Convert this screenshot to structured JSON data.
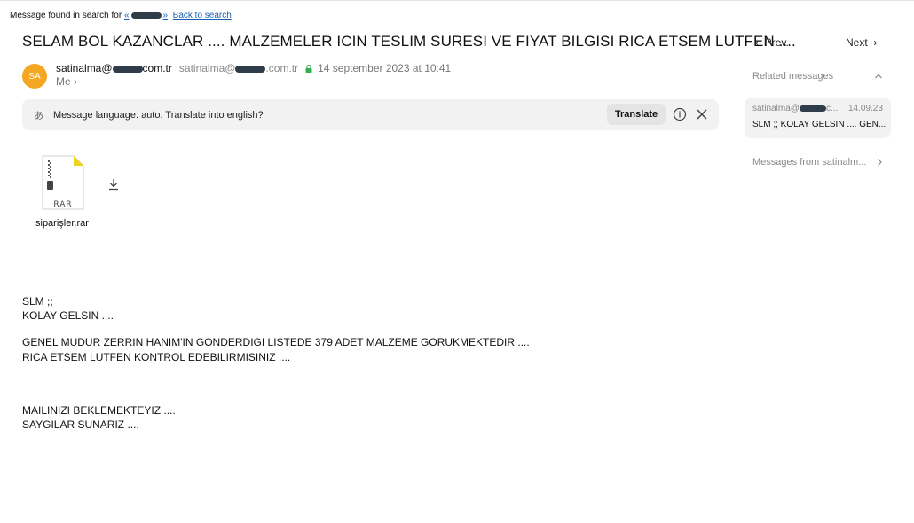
{
  "search_bar": {
    "prefix": "Message found in search for",
    "query_open": "«",
    "query_close": "»",
    "separator": ".",
    "back_link": "Back to search"
  },
  "message": {
    "subject": "SELAM BOL KAZANCLAR .... MALZEMELER ICIN TESLIM SURESI VE FIYAT BILGISI RICA ETSEM LUTFEN ....",
    "avatar_initials": "SA",
    "avatar_color": "#f5a623",
    "from_name_prefix": "satinalma@",
    "from_name_suffix": "com.tr",
    "from_email_prefix": "satinalma@",
    "from_email_suffix": ".com.tr",
    "date": "14 september 2023 at 10:41",
    "to": "Me"
  },
  "translate": {
    "text": "Message language: auto. Translate into english?",
    "button": "Translate"
  },
  "attachment": {
    "type_label": "RAR",
    "file_name": "siparişler.rar"
  },
  "body": {
    "line1": "SLM ;;",
    "line2": "KOLAY GELSIN ....",
    "line3": "GENEL MUDUR ZERRIN HANIM'IN GONDERDIGI LISTEDE 379 ADET MALZEME GORUKMEKTEDIR ....",
    "line4": "RICA ETSEM LUTFEN KONTROL EDEBILIRMISINIZ ....",
    "line5": "MAILINIZI BEKLEMEKTEYIZ ....",
    "line6": "SAYGILAR SUNARIZ ...."
  },
  "sidebar": {
    "prev": "Prev.",
    "next": "Next",
    "related_title": "Related messages",
    "related_item": {
      "from_prefix": "satinalma@",
      "from_suffix": "c...",
      "date": "14.09.23",
      "subject": "SLM ;; KOLAY GELSIN .... GEN..."
    },
    "messages_from": "Messages from satinalm..."
  },
  "colors": {
    "accent_link": "#1a5fb4",
    "lock_green": "#2fb04a",
    "panel_bg": "#f2f2f2"
  }
}
